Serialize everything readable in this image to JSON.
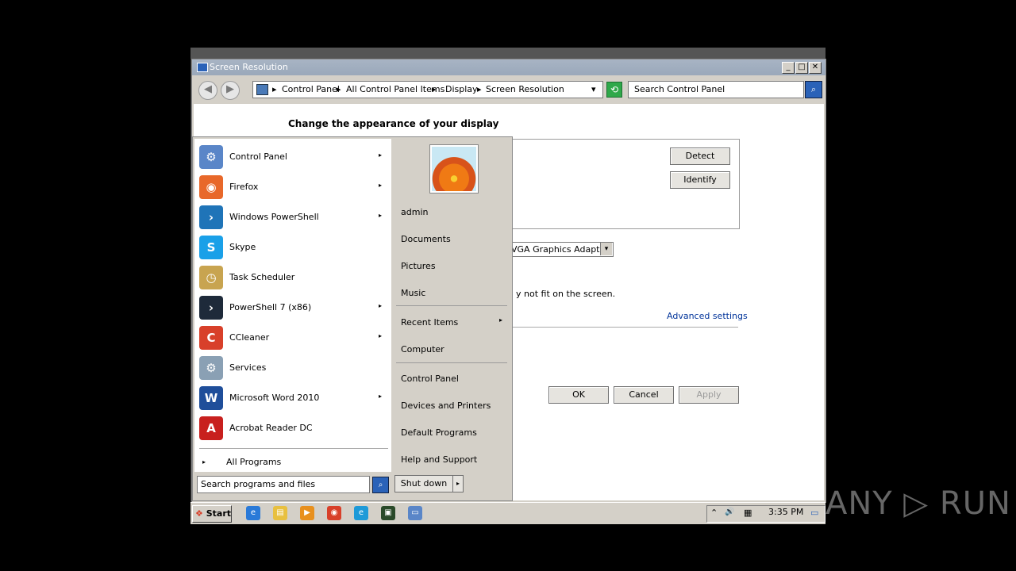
{
  "window": {
    "title": "Screen Resolution",
    "min_label": "_",
    "max_label": "□",
    "close_label": "✕"
  },
  "nav": {
    "back_label": "◀",
    "forward_label": "▶",
    "breadcrumbs": [
      "Control Panel",
      "All Control Panel Items",
      "Display",
      "Screen Resolution"
    ],
    "crumb_sep": "▸",
    "dropdown": "▾",
    "refresh_label": "⟲",
    "search_placeholder": "Search Control Panel",
    "search_icon": "⌕"
  },
  "content": {
    "heading": "Change the appearance of your display",
    "detect_label": "Detect",
    "identify_label": "Identify",
    "display_select_value": "VGA Graphics Adapter",
    "display_select_arrow": "▾",
    "note_text": "y not fit on the screen.",
    "advanced_label": "Advanced settings",
    "ok_label": "OK",
    "cancel_label": "Cancel",
    "apply_label": "Apply"
  },
  "start_menu": {
    "programs": [
      {
        "label": "Control Panel",
        "icon": "control-panel-icon",
        "color": "#5a86c8",
        "glyph": "⚙",
        "arrow": true
      },
      {
        "label": "Firefox",
        "icon": "firefox-icon",
        "color": "#e8682a",
        "glyph": "◉",
        "arrow": true
      },
      {
        "label": "Windows PowerShell",
        "icon": "powershell-icon",
        "color": "#1f74b8",
        "glyph": "›",
        "arrow": true
      },
      {
        "label": "Skype",
        "icon": "skype-icon",
        "color": "#1aa0e8",
        "glyph": "S",
        "arrow": false
      },
      {
        "label": "Task Scheduler",
        "icon": "clock-icon",
        "color": "#c8a450",
        "glyph": "◷",
        "arrow": false
      },
      {
        "label": "PowerShell 7 (x86)",
        "icon": "powershell7-icon",
        "color": "#1e2a3a",
        "glyph": "›",
        "arrow": true
      },
      {
        "label": "CCleaner",
        "icon": "ccleaner-icon",
        "color": "#d8402a",
        "glyph": "C",
        "arrow": true
      },
      {
        "label": "Services",
        "icon": "gear-icon",
        "color": "#8aa0b4",
        "glyph": "⚙",
        "arrow": false
      },
      {
        "label": "Microsoft Word 2010",
        "icon": "word-icon",
        "color": "#1f4e9a",
        "glyph": "W",
        "arrow": true
      },
      {
        "label": "Acrobat Reader DC",
        "icon": "acrobat-icon",
        "color": "#c8201e",
        "glyph": "A",
        "arrow": false
      }
    ],
    "submenu_arrow": "▸",
    "all_programs_arrow": "▸",
    "all_programs": "All Programs",
    "search_placeholder": "Search programs and files",
    "search_icon": "⌕",
    "right_links": [
      {
        "label": "admin",
        "icon": "user-link"
      },
      {
        "label": "Documents",
        "icon": "documents-link"
      },
      {
        "label": "Pictures",
        "icon": "pictures-link"
      },
      {
        "label": "Music",
        "icon": "music-link"
      },
      {
        "label": "Recent Items",
        "icon": "recent-items-link"
      },
      {
        "label": "Computer",
        "icon": "computer-link"
      },
      {
        "label": "Control Panel",
        "icon": "control-panel-link"
      },
      {
        "label": "Devices and Printers",
        "icon": "devices-link"
      },
      {
        "label": "Default Programs",
        "icon": "default-programs-link"
      },
      {
        "label": "Help and Support",
        "icon": "help-link"
      }
    ],
    "shutdown_label": "Shut down",
    "shutdown_arrow": "▸"
  },
  "taskbar": {
    "start_label": "Start",
    "start_logo": "❖",
    "icons": [
      {
        "name": "ie-icon",
        "color": "#2a7ad8",
        "glyph": "e"
      },
      {
        "name": "explorer-icon",
        "color": "#e8c040",
        "glyph": "▤"
      },
      {
        "name": "media-player-icon",
        "color": "#e8901e",
        "glyph": "▶"
      },
      {
        "name": "chrome-icon",
        "color": "#d8402a",
        "glyph": "◉"
      },
      {
        "name": "edge-icon",
        "color": "#1e9ad8",
        "glyph": "e"
      },
      {
        "name": "terminal-icon",
        "color": "#2a4a2a",
        "glyph": "▣"
      },
      {
        "name": "screen-resolution-icon",
        "color": "#5a86c8",
        "glyph": "▭"
      }
    ],
    "tray_chevron": "⌃",
    "volume_icon": "🔊",
    "network_icon": "▦",
    "time": "3:35 PM",
    "monitor_icon": "▭"
  },
  "watermark": "ANY ▷ RUN"
}
